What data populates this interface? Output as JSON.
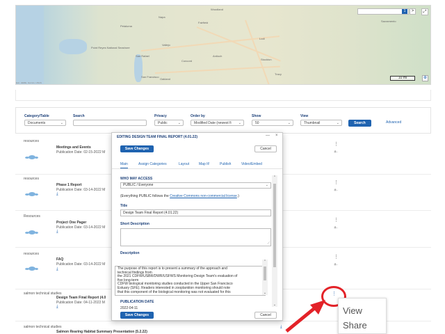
{
  "map": {
    "labels": [
      "Woodland",
      "Napa",
      "Fairfield",
      "Petaluma",
      "Vallejo",
      "Lodi",
      "Point Reyes National Seashore",
      "San Rafael",
      "Concord",
      "Antioch",
      "Stockton",
      "San Francisco",
      "Oakland",
      "Tracy",
      "Sacramento"
    ],
    "result_count": "1",
    "next_icon": ">",
    "expand_icon": "⤢",
    "scale_label": "10 mi",
    "locate_icon": "⊕",
    "attribution": "Esri, HERE, Garmin, USGS"
  },
  "filters": {
    "category_label": "Category/Table",
    "category_value": "Documents",
    "search_label": "Search",
    "search_value": "",
    "privacy_label": "Privacy",
    "privacy_value": "Public",
    "order_label": "Order by",
    "order_value": "Modified Date (newest fi",
    "show_label": "Show",
    "show_value": "50",
    "view_label": "View",
    "view_value": "Thumbnail",
    "search_button": "Search",
    "advanced_link": "Advanced"
  },
  "items": [
    {
      "category": "resources",
      "title": "Meetings and Events",
      "date": "Publication Date: 02-15-2022 M",
      "share": "≗·"
    },
    {
      "category": "resources",
      "title": "Phase 1 Report",
      "date": "Publication Date: 03-14-2022 M",
      "share": "≗·"
    },
    {
      "category": "Resources",
      "title": "Project One Pager",
      "date": "Publication Date: 03-14-2022 M",
      "share": "≗·"
    },
    {
      "category": "resources",
      "title": "FAQ",
      "date": "Publication Date: 03-14-2022 M",
      "share": "≗·"
    },
    {
      "category": "salmon technical studies",
      "title": "Design Team Final Report (4.0",
      "date": "Publication Date: 04-11-2022 M",
      "share": ""
    },
    {
      "category": "salmon technical studies",
      "title": "Salmon Rearing Habitat Summary Presentation (5.2.22)",
      "date": "",
      "share": ""
    }
  ],
  "download_icon": "⤓",
  "modal": {
    "title": "EDITING DESIGN TEAM FINAL REPORT (4.01.22)",
    "minimize": "—",
    "close": "×",
    "save_button": "Save Changes",
    "cancel_button": "Cancel",
    "tabs": [
      "Main",
      "Assign Categories",
      "Layout",
      "Map It!",
      "Publish",
      "Video/Embed"
    ],
    "access_heading": "WHO MAY ACCESS",
    "access_value": "PUBLIC / Everyone",
    "license_prefix": "(Everything PUBLIC follows the ",
    "license_link": "Creative Commons non-commercial license",
    "license_suffix": ".)",
    "title_label": "Title",
    "title_value": "Design Team Final Report (4.01.22)",
    "short_desc_label": "Short Description",
    "description_label": "Description",
    "description_lines": [
      "The purpose of this report is to present a summary of the approach and",
      "technical findings from",
      "the 2021 CDFW/USBR/DWR/USFWS Monitoring Design Team's evaluation of",
      "five long-term",
      "CDFW biological monitoring studies conducted in the Upper San Francisco",
      "Estuary (SFE).  Readers interested in zooplankton monitoring should note",
      "that this component of the biological monitoring was not evaluated for this"
    ],
    "pub_date_label": "PUBLICATION DATE",
    "pub_date_value": "2022-04-11",
    "footer_save": "Save Changes",
    "footer_cancel": "Cancel"
  },
  "context_menu": {
    "items": [
      "View",
      "Share"
    ]
  },
  "colors": {
    "primary": "#1f63b0",
    "heading": "#1b3f78",
    "callout": "#e32228"
  }
}
